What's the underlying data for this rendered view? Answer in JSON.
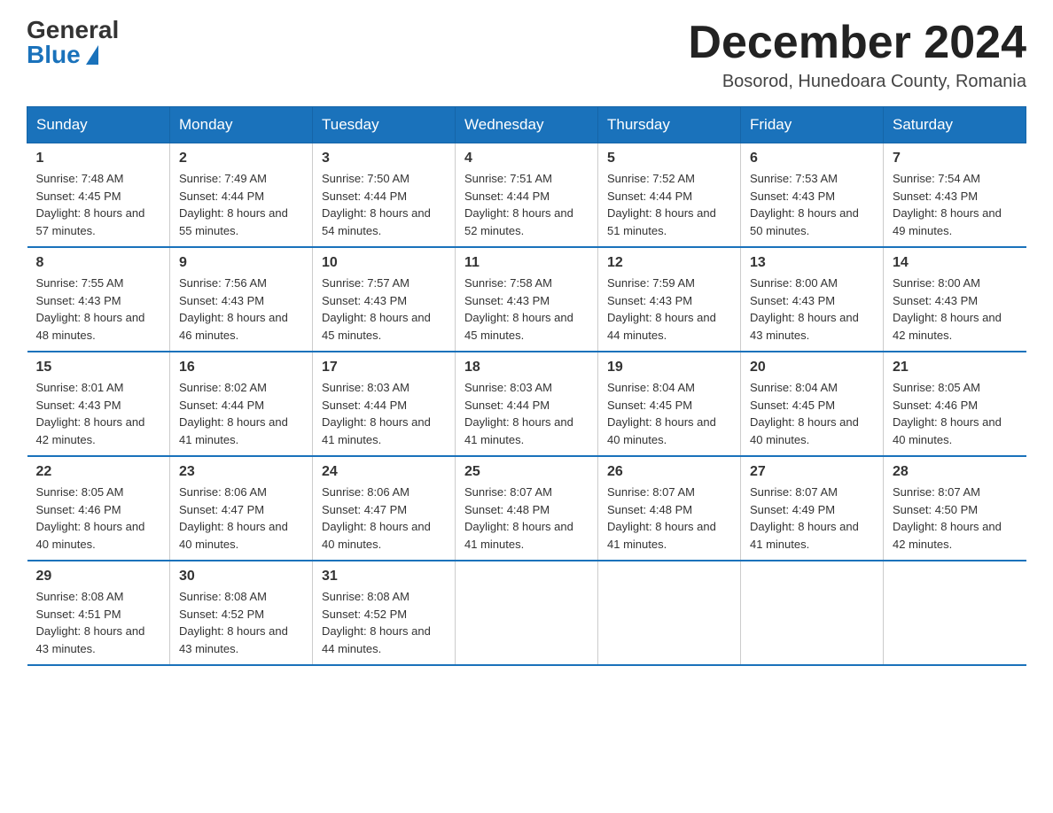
{
  "logo": {
    "general": "General",
    "blue": "Blue"
  },
  "title": "December 2024",
  "location": "Bosorod, Hunedoara County, Romania",
  "days_of_week": [
    "Sunday",
    "Monday",
    "Tuesday",
    "Wednesday",
    "Thursday",
    "Friday",
    "Saturday"
  ],
  "weeks": [
    [
      {
        "day": "1",
        "sunrise": "7:48 AM",
        "sunset": "4:45 PM",
        "daylight": "8 hours and 57 minutes."
      },
      {
        "day": "2",
        "sunrise": "7:49 AM",
        "sunset": "4:44 PM",
        "daylight": "8 hours and 55 minutes."
      },
      {
        "day": "3",
        "sunrise": "7:50 AM",
        "sunset": "4:44 PM",
        "daylight": "8 hours and 54 minutes."
      },
      {
        "day": "4",
        "sunrise": "7:51 AM",
        "sunset": "4:44 PM",
        "daylight": "8 hours and 52 minutes."
      },
      {
        "day": "5",
        "sunrise": "7:52 AM",
        "sunset": "4:44 PM",
        "daylight": "8 hours and 51 minutes."
      },
      {
        "day": "6",
        "sunrise": "7:53 AM",
        "sunset": "4:43 PM",
        "daylight": "8 hours and 50 minutes."
      },
      {
        "day": "7",
        "sunrise": "7:54 AM",
        "sunset": "4:43 PM",
        "daylight": "8 hours and 49 minutes."
      }
    ],
    [
      {
        "day": "8",
        "sunrise": "7:55 AM",
        "sunset": "4:43 PM",
        "daylight": "8 hours and 48 minutes."
      },
      {
        "day": "9",
        "sunrise": "7:56 AM",
        "sunset": "4:43 PM",
        "daylight": "8 hours and 46 minutes."
      },
      {
        "day": "10",
        "sunrise": "7:57 AM",
        "sunset": "4:43 PM",
        "daylight": "8 hours and 45 minutes."
      },
      {
        "day": "11",
        "sunrise": "7:58 AM",
        "sunset": "4:43 PM",
        "daylight": "8 hours and 45 minutes."
      },
      {
        "day": "12",
        "sunrise": "7:59 AM",
        "sunset": "4:43 PM",
        "daylight": "8 hours and 44 minutes."
      },
      {
        "day": "13",
        "sunrise": "8:00 AM",
        "sunset": "4:43 PM",
        "daylight": "8 hours and 43 minutes."
      },
      {
        "day": "14",
        "sunrise": "8:00 AM",
        "sunset": "4:43 PM",
        "daylight": "8 hours and 42 minutes."
      }
    ],
    [
      {
        "day": "15",
        "sunrise": "8:01 AM",
        "sunset": "4:43 PM",
        "daylight": "8 hours and 42 minutes."
      },
      {
        "day": "16",
        "sunrise": "8:02 AM",
        "sunset": "4:44 PM",
        "daylight": "8 hours and 41 minutes."
      },
      {
        "day": "17",
        "sunrise": "8:03 AM",
        "sunset": "4:44 PM",
        "daylight": "8 hours and 41 minutes."
      },
      {
        "day": "18",
        "sunrise": "8:03 AM",
        "sunset": "4:44 PM",
        "daylight": "8 hours and 41 minutes."
      },
      {
        "day": "19",
        "sunrise": "8:04 AM",
        "sunset": "4:45 PM",
        "daylight": "8 hours and 40 minutes."
      },
      {
        "day": "20",
        "sunrise": "8:04 AM",
        "sunset": "4:45 PM",
        "daylight": "8 hours and 40 minutes."
      },
      {
        "day": "21",
        "sunrise": "8:05 AM",
        "sunset": "4:46 PM",
        "daylight": "8 hours and 40 minutes."
      }
    ],
    [
      {
        "day": "22",
        "sunrise": "8:05 AM",
        "sunset": "4:46 PM",
        "daylight": "8 hours and 40 minutes."
      },
      {
        "day": "23",
        "sunrise": "8:06 AM",
        "sunset": "4:47 PM",
        "daylight": "8 hours and 40 minutes."
      },
      {
        "day": "24",
        "sunrise": "8:06 AM",
        "sunset": "4:47 PM",
        "daylight": "8 hours and 40 minutes."
      },
      {
        "day": "25",
        "sunrise": "8:07 AM",
        "sunset": "4:48 PM",
        "daylight": "8 hours and 41 minutes."
      },
      {
        "day": "26",
        "sunrise": "8:07 AM",
        "sunset": "4:48 PM",
        "daylight": "8 hours and 41 minutes."
      },
      {
        "day": "27",
        "sunrise": "8:07 AM",
        "sunset": "4:49 PM",
        "daylight": "8 hours and 41 minutes."
      },
      {
        "day": "28",
        "sunrise": "8:07 AM",
        "sunset": "4:50 PM",
        "daylight": "8 hours and 42 minutes."
      }
    ],
    [
      {
        "day": "29",
        "sunrise": "8:08 AM",
        "sunset": "4:51 PM",
        "daylight": "8 hours and 43 minutes."
      },
      {
        "day": "30",
        "sunrise": "8:08 AM",
        "sunset": "4:52 PM",
        "daylight": "8 hours and 43 minutes."
      },
      {
        "day": "31",
        "sunrise": "8:08 AM",
        "sunset": "4:52 PM",
        "daylight": "8 hours and 44 minutes."
      },
      null,
      null,
      null,
      null
    ]
  ]
}
